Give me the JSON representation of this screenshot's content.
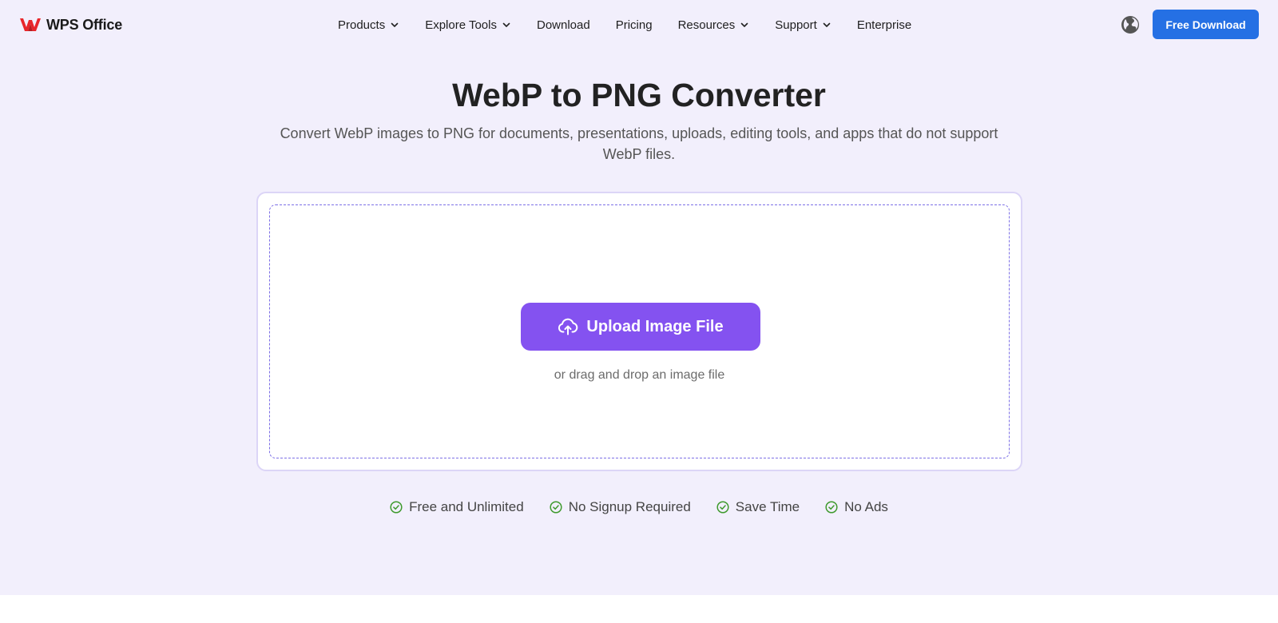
{
  "brand": {
    "name": "WPS Office",
    "logo_color": "#e8262b"
  },
  "nav": {
    "items": [
      {
        "label": "Products",
        "dropdown": true
      },
      {
        "label": "Explore Tools",
        "dropdown": true
      },
      {
        "label": "Download",
        "dropdown": false
      },
      {
        "label": "Pricing",
        "dropdown": false
      },
      {
        "label": "Resources",
        "dropdown": true
      },
      {
        "label": "Support",
        "dropdown": true
      },
      {
        "label": "Enterprise",
        "dropdown": false
      }
    ],
    "language_icon": "globe-icon",
    "cta_label": "Free Download",
    "cta_color": "#2570e4"
  },
  "hero": {
    "title": "WebP to PNG Converter",
    "subtitle": "Convert WebP images to PNG for documents, presentations, uploads, editing tools, and apps that do not support WebP files."
  },
  "upload": {
    "button_label": "Upload Image File",
    "button_icon": "cloud-upload-icon",
    "button_color": "#8452f0",
    "hint": "or drag and drop an image file"
  },
  "features": [
    {
      "label": "Free and Unlimited",
      "icon": "check-circle-icon"
    },
    {
      "label": "No Signup Required",
      "icon": "check-circle-icon"
    },
    {
      "label": "Save Time",
      "icon": "check-circle-icon"
    },
    {
      "label": "No Ads",
      "icon": "check-circle-icon"
    }
  ],
  "colors": {
    "hero_background": "#f2effc",
    "check_green": "#3f9a2e"
  }
}
